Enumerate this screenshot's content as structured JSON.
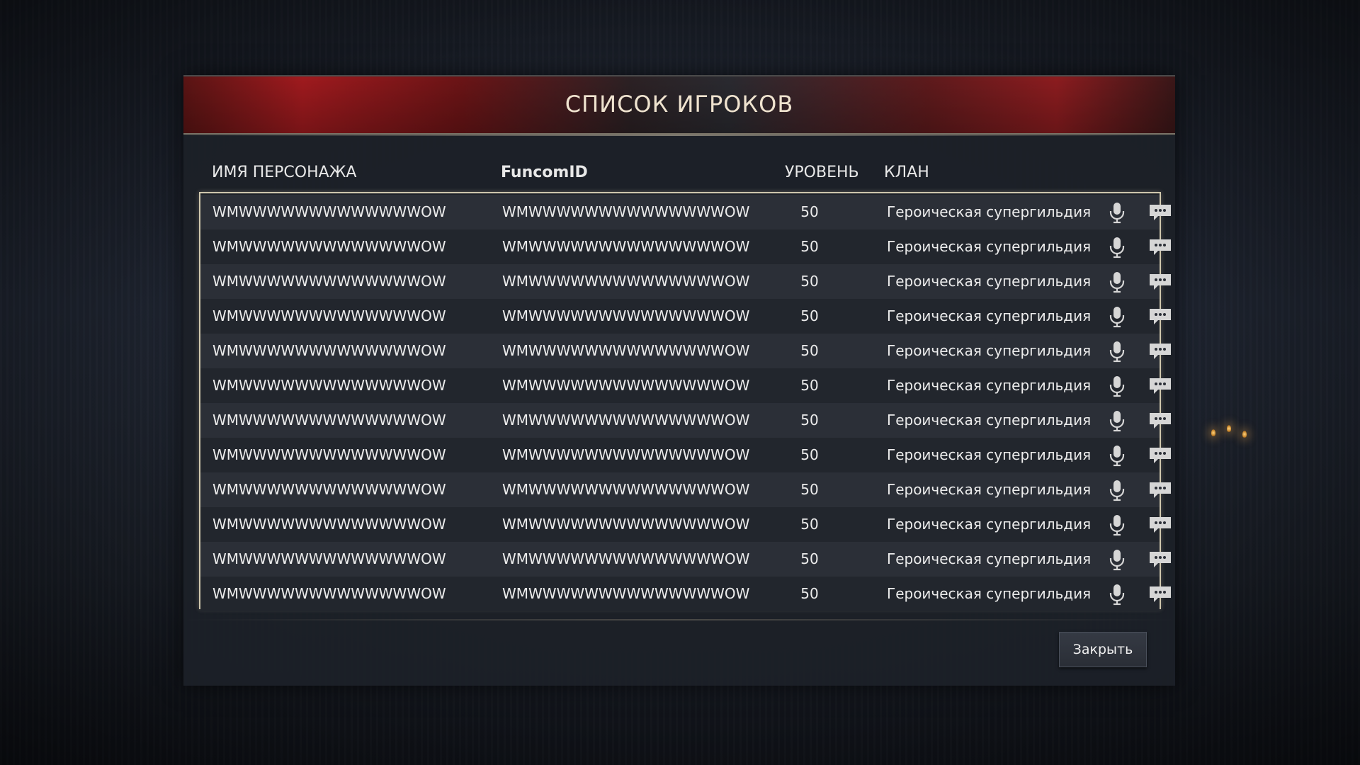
{
  "window": {
    "title": "СПИСОК ИГРОКОВ"
  },
  "columns": {
    "name": "ИМЯ ПЕРСОНАЖА",
    "funcom_id": "FuncomID",
    "level": "УРОВЕНЬ",
    "clan": "КЛАН"
  },
  "players": [
    {
      "name": "WMWWWWWWWWWWWWWOW",
      "funcom_id": "WMWWWWWWWWWWWWWWOW",
      "level": "50",
      "clan": "Героическая супергильдия"
    },
    {
      "name": "WMWWWWWWWWWWWWWOW",
      "funcom_id": "WMWWWWWWWWWWWWWWOW",
      "level": "50",
      "clan": "Героическая супергильдия"
    },
    {
      "name": "WMWWWWWWWWWWWWWOW",
      "funcom_id": "WMWWWWWWWWWWWWWWOW",
      "level": "50",
      "clan": "Героическая супергильдия"
    },
    {
      "name": "WMWWWWWWWWWWWWWOW",
      "funcom_id": "WMWWWWWWWWWWWWWWOW",
      "level": "50",
      "clan": "Героическая супергильдия"
    },
    {
      "name": "WMWWWWWWWWWWWWWOW",
      "funcom_id": "WMWWWWWWWWWWWWWWOW",
      "level": "50",
      "clan": "Героическая супергильдия"
    },
    {
      "name": "WMWWWWWWWWWWWWWOW",
      "funcom_id": "WMWWWWWWWWWWWWWWOW",
      "level": "50",
      "clan": "Героическая супергильдия"
    },
    {
      "name": "WMWWWWWWWWWWWWWOW",
      "funcom_id": "WMWWWWWWWWWWWWWWOW",
      "level": "50",
      "clan": "Героическая супергильдия"
    },
    {
      "name": "WMWWWWWWWWWWWWWOW",
      "funcom_id": "WMWWWWWWWWWWWWWWOW",
      "level": "50",
      "clan": "Героическая супергильдия"
    },
    {
      "name": "WMWWWWWWWWWWWWWOW",
      "funcom_id": "WMWWWWWWWWWWWWWWOW",
      "level": "50",
      "clan": "Героическая супергильдия"
    },
    {
      "name": "WMWWWWWWWWWWWWWOW",
      "funcom_id": "WMWWWWWWWWWWWWWWOW",
      "level": "50",
      "clan": "Героическая супергильдия"
    },
    {
      "name": "WMWWWWWWWWWWWWWOW",
      "funcom_id": "WMWWWWWWWWWWWWWWOW",
      "level": "50",
      "clan": "Героическая супергильдия"
    },
    {
      "name": "WMWWWWWWWWWWWWWOW",
      "funcom_id": "WMWWWWWWWWWWWWWWOW",
      "level": "50",
      "clan": "Героическая супергильдия"
    }
  ],
  "row_icons": {
    "voice": "microphone-icon",
    "message": "chat-bubble-icon"
  },
  "footer": {
    "close_label": "Закрыть"
  },
  "colors": {
    "banner_red": "#a01a1e",
    "list_border": "#cfc7ad",
    "panel_bg": "#1c2028"
  }
}
